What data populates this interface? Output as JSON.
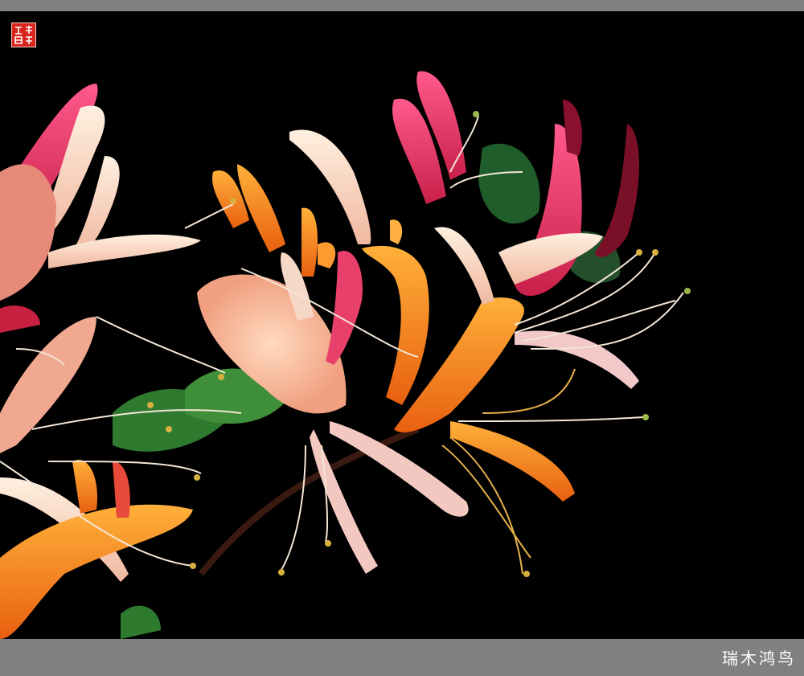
{
  "photo": {
    "subject_icon": "honeysuckle-flower-cluster",
    "background_color": "#000000",
    "frame_color": "#808080"
  },
  "seal": {
    "text": "瑞木鸿鸟",
    "color": "#d8241c"
  },
  "caption": {
    "text": "瑞木鸿鸟"
  }
}
